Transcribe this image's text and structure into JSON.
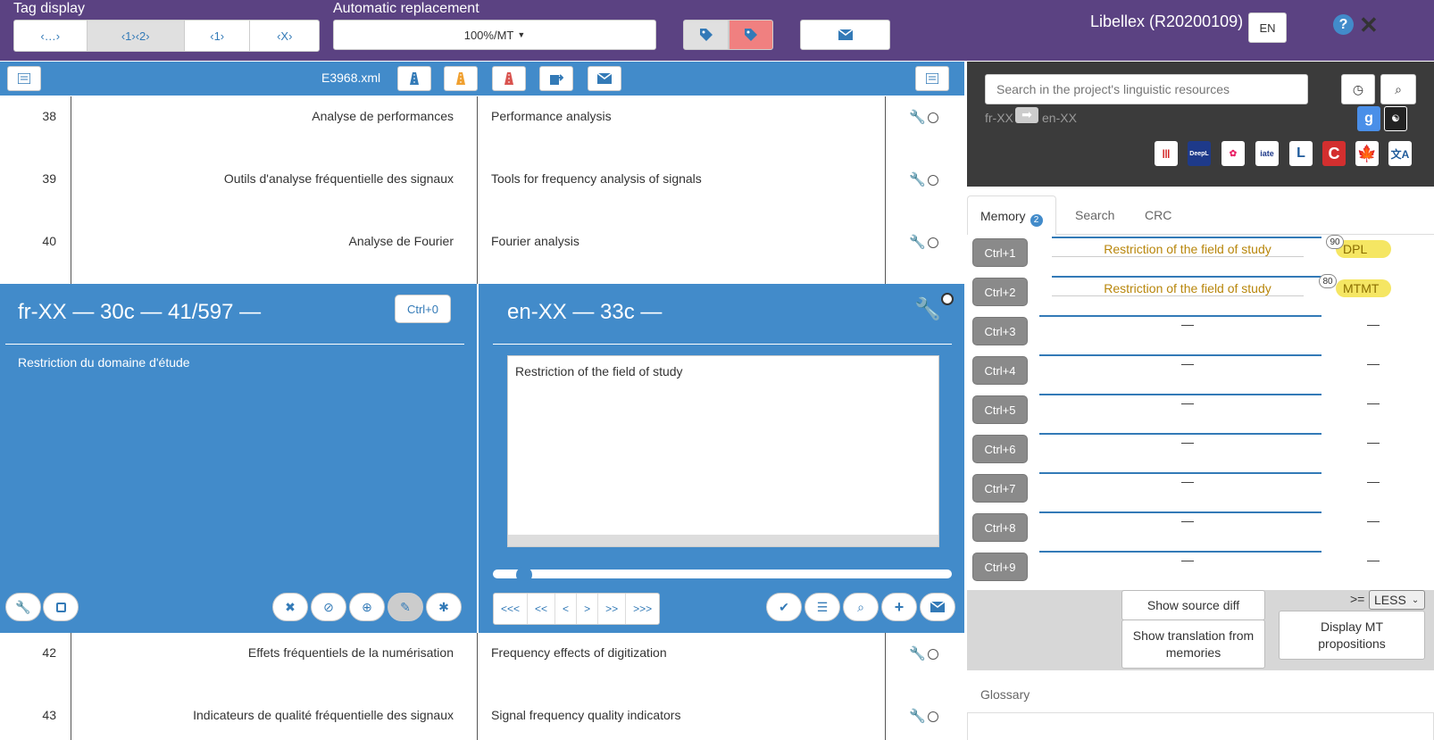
{
  "topbar": {
    "tag_display_label": "Tag display",
    "tag_buttons": [
      "‹…›",
      "‹1›‹2›",
      "‹1›",
      "‹X›"
    ],
    "auto_replace_label": "Automatic replacement",
    "auto_replace_value": "100%/MT",
    "app_title": "Libellex (R20200109)",
    "lang_button": "EN"
  },
  "docbar": {
    "filename": "E3968.xml"
  },
  "rows_top": [
    {
      "num": "38",
      "src": "Analyse de performances",
      "tgt": "Performance analysis"
    },
    {
      "num": "39",
      "src": "Outils d'analyse fréquentielle des signaux",
      "tgt": "Tools for frequency analysis of signals"
    },
    {
      "num": "40",
      "src": "Analyse de Fourier",
      "tgt": "Fourier analysis"
    }
  ],
  "rows_bottom": [
    {
      "num": "42",
      "src": "Effets fréquentiels de la numérisation",
      "tgt": "Frequency effects of digitization"
    },
    {
      "num": "43",
      "src": "Indicateurs de qualité fréquentielle des signaux",
      "tgt": "Signal frequency quality indicators"
    }
  ],
  "editor": {
    "src_header": "fr-XX — 30c — 41/597 —",
    "ctrl0": "Ctrl+0",
    "src_text": "Restriction du domaine d'étude",
    "tgt_header": "en-XX — 33c —",
    "tgt_text": "Restriction of the field of study",
    "nav_buttons": [
      "<<<",
      "<<",
      "<",
      ">",
      ">>",
      ">>>"
    ]
  },
  "resources": {
    "search_placeholder": "Search in the project's linguistic resources",
    "lang_from": "fr-XX",
    "lang_to": "en-XX"
  },
  "tabs": {
    "memory": "Memory",
    "memory_badge": "2",
    "search": "Search",
    "crc": "CRC"
  },
  "matches": [
    {
      "key": "Ctrl+1",
      "text": "Restriction of the field of study",
      "score": "90",
      "origin": "DPL"
    },
    {
      "key": "Ctrl+2",
      "text": "Restriction of the field of study",
      "score": "80",
      "origin": "MTMT"
    },
    {
      "key": "Ctrl+3",
      "text": "—",
      "origin": "—"
    },
    {
      "key": "Ctrl+4",
      "text": "—",
      "origin": "—"
    },
    {
      "key": "Ctrl+5",
      "text": "—",
      "origin": "—"
    },
    {
      "key": "Ctrl+6",
      "text": "—",
      "origin": "—"
    },
    {
      "key": "Ctrl+7",
      "text": "—",
      "origin": "—"
    },
    {
      "key": "Ctrl+8",
      "text": "—",
      "origin": "—"
    },
    {
      "key": "Ctrl+9",
      "text": "—",
      "origin": "—"
    }
  ],
  "controls": {
    "show_source_diff": "Show source diff",
    "show_translation": "Show translation from memories",
    "display_mt": "Display MT propositions",
    "ge_label": ">=",
    "less_select": "LESS"
  },
  "glossary_label": "Glossary",
  "colors": {
    "topbar": "#5b4282",
    "panel_blue": "#428bca",
    "dark_panel": "#3b3b3b",
    "origin_yellow": "#f5e663"
  }
}
